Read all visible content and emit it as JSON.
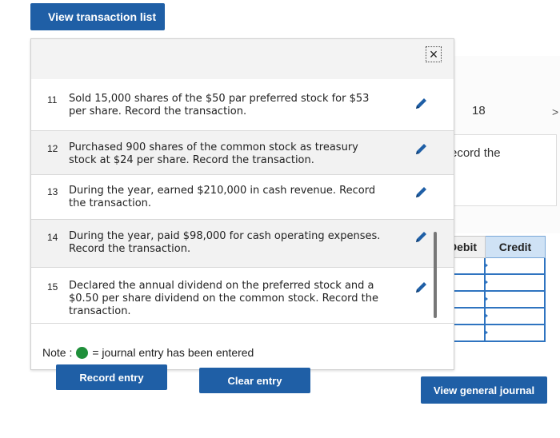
{
  "top_button": "View transaction list",
  "background": {
    "number": "18",
    "chevron": ">",
    "record_text": "ecord the"
  },
  "journal": {
    "debit_header": "Debit",
    "credit_header": "Credit",
    "row_count": 5
  },
  "view_general_journal": "View general journal",
  "popup": {
    "close_icon": "×",
    "transactions": [
      {
        "num": "11",
        "text": "Sold 15,000 shares of the $50 par preferred stock for $53 per share. Record the transaction."
      },
      {
        "num": "12",
        "text": "Purchased 900 shares of the common stock as treasury stock at $24 per share. Record the transaction."
      },
      {
        "num": "13",
        "text": "During the year, earned $210,000 in cash revenue. Record the transaction."
      },
      {
        "num": "14",
        "text": "During the year, paid $98,000 for cash operating expenses. Record the transaction."
      },
      {
        "num": "15",
        "text": "Declared the annual dividend on the preferred stock and a $0.50 per share dividend on the common stock. Record the transaction."
      }
    ],
    "note_label": "Note :",
    "note_text": "= journal entry has been entered",
    "record_entry": "Record entry",
    "clear_entry": "Clear entry"
  },
  "colors": {
    "button_blue": "#1f5fa6",
    "entered_green": "#1f8f3a",
    "pencil_blue": "#1f5fa6"
  }
}
